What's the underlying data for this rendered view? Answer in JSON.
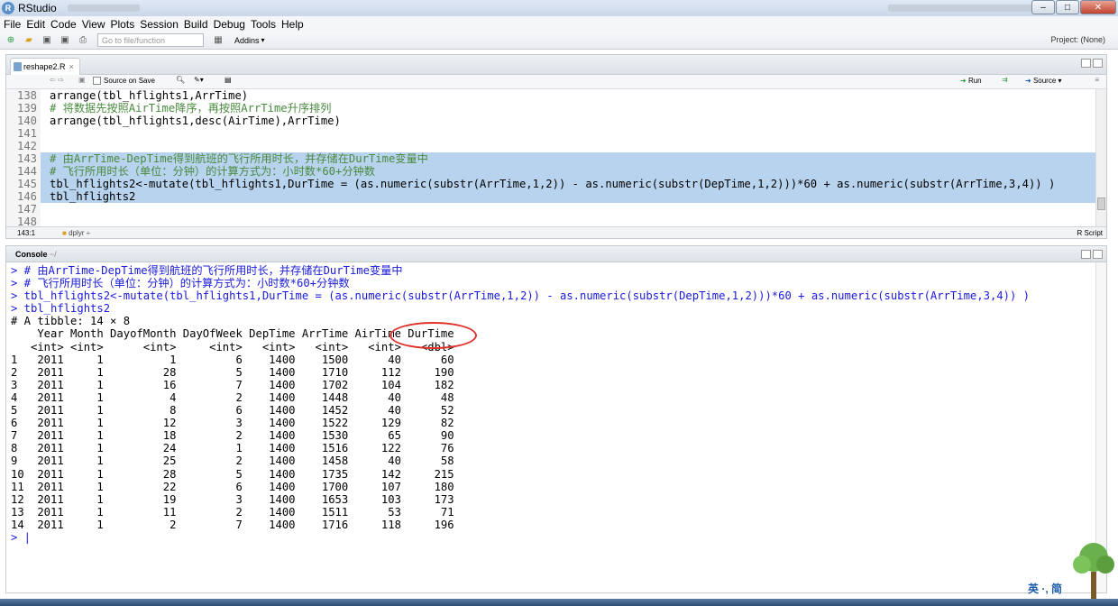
{
  "window": {
    "title": "RStudio"
  },
  "menu": [
    "File",
    "Edit",
    "Code",
    "View",
    "Plots",
    "Session",
    "Build",
    "Debug",
    "Tools",
    "Help"
  ],
  "toolbar": {
    "goto_placeholder": "Go to file/function",
    "addins": "Addins",
    "project": "Project: (None)"
  },
  "editor": {
    "tab": "reshape2.R",
    "source_on_save": "Source on Save",
    "run": "Run",
    "source": "Source",
    "lines": [
      {
        "n": "138",
        "t": "arrange(tbl_hflights1,ArrTime)",
        "c": false,
        "s": false
      },
      {
        "n": "139",
        "t": "# 将数据先按照AirTime降序，再按照ArrTime升序排列",
        "c": true,
        "s": false
      },
      {
        "n": "140",
        "t": "arrange(tbl_hflights1,desc(AirTime),ArrTime)",
        "c": false,
        "s": false
      },
      {
        "n": "141",
        "t": "",
        "c": false,
        "s": false
      },
      {
        "n": "142",
        "t": "",
        "c": false,
        "s": false
      },
      {
        "n": "143",
        "t": "# 由ArrTime-DepTime得到航班的飞行所用时长，并存储在DurTime变量中",
        "c": true,
        "s": true
      },
      {
        "n": "144",
        "t": "# 飞行所用时长（单位：分钟）的计算方式为：小时数*60+分钟数",
        "c": true,
        "s": true
      },
      {
        "n": "145",
        "t": "tbl_hflights2<-mutate(tbl_hflights1,DurTime = (as.numeric(substr(ArrTime,1,2)) - as.numeric(substr(DepTime,1,2)))*60 + as.numeric(substr(ArrTime,3,4)) )",
        "c": false,
        "s": true
      },
      {
        "n": "146",
        "t": "tbl_hflights2",
        "c": false,
        "s": true
      },
      {
        "n": "147",
        "t": "",
        "c": false,
        "s": false
      },
      {
        "n": "148",
        "t": "",
        "c": false,
        "s": false
      }
    ],
    "status_pos": "143:1",
    "status_fn": "dplyr",
    "status_type": "R Script"
  },
  "console": {
    "label": "Console",
    "path": "~/",
    "lines": [
      {
        "t": "> # 由ArrTime-DepTime得到航班的飞行所用时长，并存储在DurTime变量中",
        "b": true
      },
      {
        "t": "> # 飞行所用时长（单位：分钟）的计算方式为：小时数*60+分钟数",
        "b": true
      },
      {
        "t": "> tbl_hflights2<-mutate(tbl_hflights1,DurTime = (as.numeric(substr(ArrTime,1,2)) - as.numeric(substr(DepTime,1,2)))*60 + as.numeric(substr(ArrTime,3,4)) )",
        "b": true
      },
      {
        "t": "> tbl_hflights2",
        "b": true
      },
      {
        "t": "# A tibble: 14 × 8",
        "b": false
      },
      {
        "t": "    Year Month DayofMonth DayOfWeek DepTime ArrTime AirTime DurTime",
        "b": false
      },
      {
        "t": "   <int> <int>      <int>     <int>   <int>   <int>   <int>   <dbl>",
        "b": false
      },
      {
        "t": "1   2011     1          1         6    1400    1500      40      60",
        "b": false
      },
      {
        "t": "2   2011     1         28         5    1400    1710     112     190",
        "b": false
      },
      {
        "t": "3   2011     1         16         7    1400    1702     104     182",
        "b": false
      },
      {
        "t": "4   2011     1          4         2    1400    1448      40      48",
        "b": false
      },
      {
        "t": "5   2011     1          8         6    1400    1452      40      52",
        "b": false
      },
      {
        "t": "6   2011     1         12         3    1400    1522     129      82",
        "b": false
      },
      {
        "t": "7   2011     1         18         2    1400    1530      65      90",
        "b": false
      },
      {
        "t": "8   2011     1         24         1    1400    1516     122      76",
        "b": false
      },
      {
        "t": "9   2011     1         25         2    1400    1458      40      58",
        "b": false
      },
      {
        "t": "10  2011     1         28         5    1400    1735     142     215",
        "b": false
      },
      {
        "t": "11  2011     1         22         6    1400    1700     107     180",
        "b": false
      },
      {
        "t": "12  2011     1         19         3    1400    1653     103     173",
        "b": false
      },
      {
        "t": "13  2011     1         11         2    1400    1511      53      71",
        "b": false
      },
      {
        "t": "14  2011     1          2         7    1400    1716     118     196",
        "b": false
      },
      {
        "t": "> |",
        "b": true
      }
    ]
  },
  "ime": "英 ·, 简"
}
